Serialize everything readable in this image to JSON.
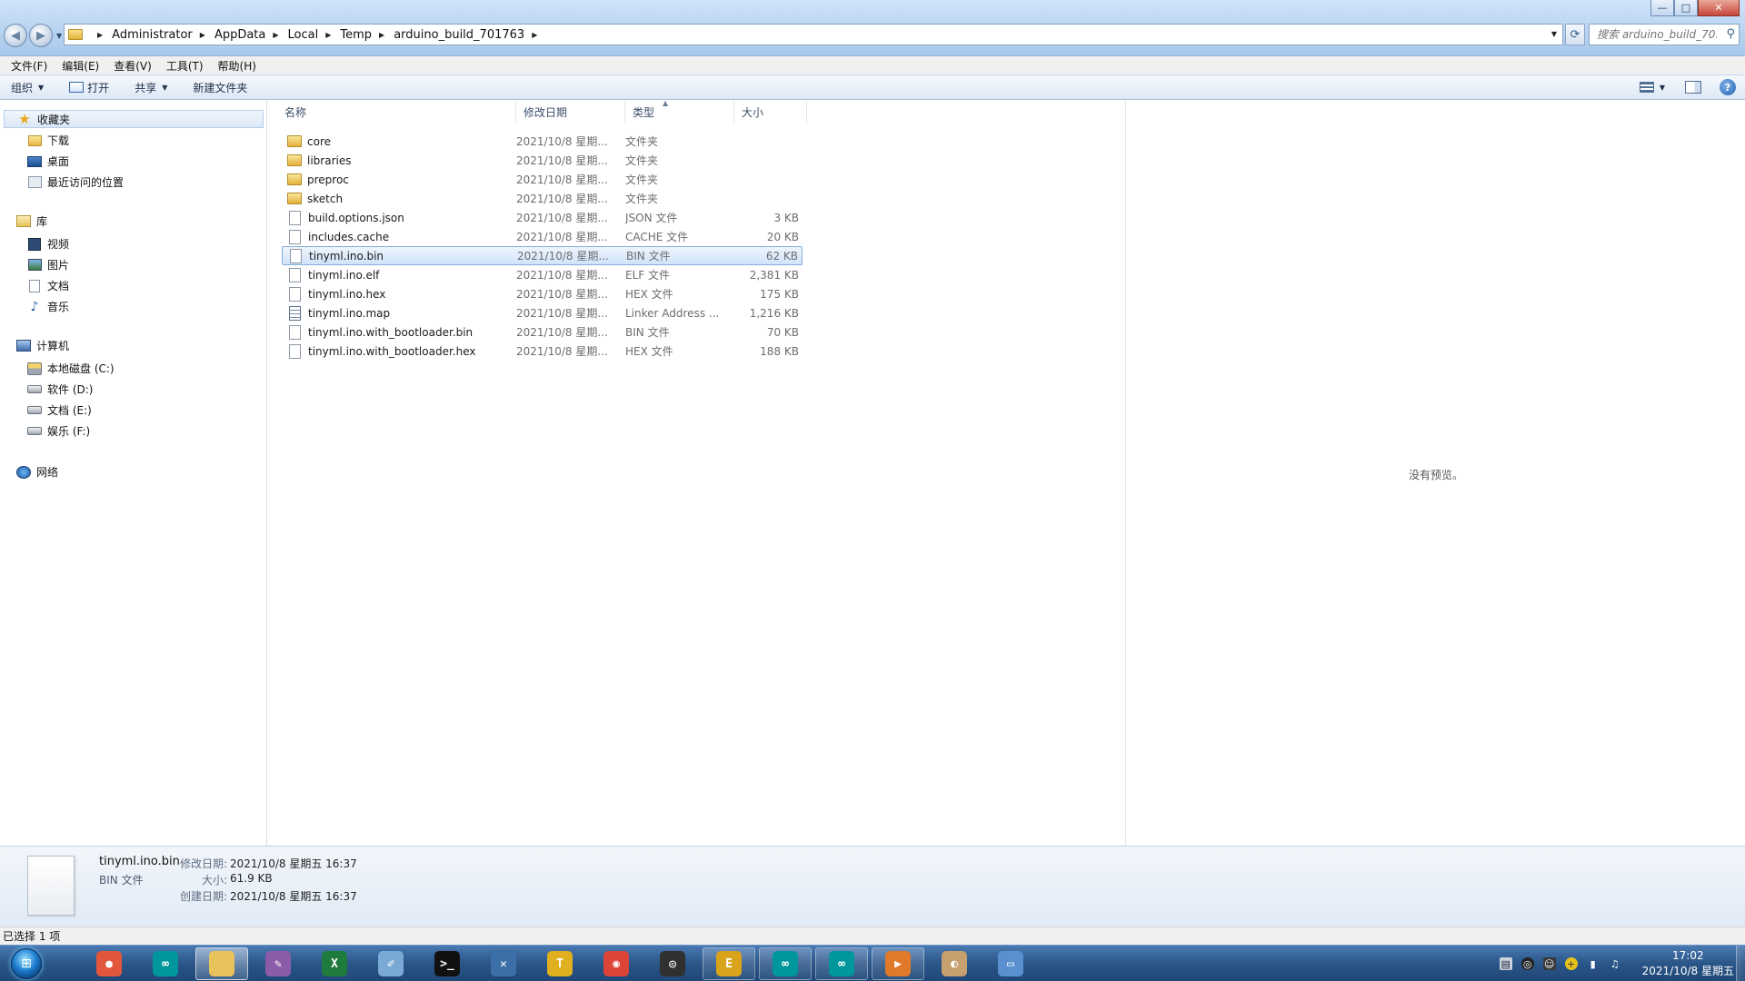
{
  "window": {
    "breadcrumbs": [
      "Administrator",
      "AppData",
      "Local",
      "Temp",
      "arduino_build_701763"
    ],
    "search_placeholder": "搜索 arduino_build_70...",
    "controls": {
      "minimize": "—",
      "maximize": "□",
      "close": "✕"
    }
  },
  "menu": [
    "文件(F)",
    "编辑(E)",
    "查看(V)",
    "工具(T)",
    "帮助(H)"
  ],
  "commands": {
    "organize": "组织",
    "open": "打开",
    "share": "共享",
    "new_folder": "新建文件夹"
  },
  "nav": {
    "favorites": {
      "label": "收藏夹",
      "items": [
        "下载",
        "桌面",
        "最近访问的位置"
      ]
    },
    "libraries": {
      "label": "库",
      "items": [
        "视频",
        "图片",
        "文档",
        "音乐"
      ]
    },
    "computer": {
      "label": "计算机",
      "items": [
        "本地磁盘 (C:)",
        "软件 (D:)",
        "文档 (E:)",
        "娱乐 (F:)"
      ]
    },
    "network": {
      "label": "网络"
    }
  },
  "columns": {
    "name": "名称",
    "date": "修改日期",
    "type": "类型",
    "size": "大小"
  },
  "files": [
    {
      "name": "core",
      "date": "2021/10/8 星期...",
      "type": "文件夹",
      "size": "",
      "kind": "folder"
    },
    {
      "name": "libraries",
      "date": "2021/10/8 星期...",
      "type": "文件夹",
      "size": "",
      "kind": "folder"
    },
    {
      "name": "preproc",
      "date": "2021/10/8 星期...",
      "type": "文件夹",
      "size": "",
      "kind": "folder"
    },
    {
      "name": "sketch",
      "date": "2021/10/8 星期...",
      "type": "文件夹",
      "size": "",
      "kind": "folder"
    },
    {
      "name": "build.options.json",
      "date": "2021/10/8 星期...",
      "type": "JSON 文件",
      "size": "3 KB",
      "kind": "file"
    },
    {
      "name": "includes.cache",
      "date": "2021/10/8 星期...",
      "type": "CACHE 文件",
      "size": "20 KB",
      "kind": "file"
    },
    {
      "name": "tinyml.ino.bin",
      "date": "2021/10/8 星期...",
      "type": "BIN 文件",
      "size": "62 KB",
      "kind": "file",
      "selected": true
    },
    {
      "name": "tinyml.ino.elf",
      "date": "2021/10/8 星期...",
      "type": "ELF 文件",
      "size": "2,381 KB",
      "kind": "file"
    },
    {
      "name": "tinyml.ino.hex",
      "date": "2021/10/8 星期...",
      "type": "HEX 文件",
      "size": "175 KB",
      "kind": "file"
    },
    {
      "name": "tinyml.ino.map",
      "date": "2021/10/8 星期...",
      "type": "Linker Address ...",
      "size": "1,216 KB",
      "kind": "map"
    },
    {
      "name": "tinyml.ino.with_bootloader.bin",
      "date": "2021/10/8 星期...",
      "type": "BIN 文件",
      "size": "70 KB",
      "kind": "file"
    },
    {
      "name": "tinyml.ino.with_bootloader.hex",
      "date": "2021/10/8 星期...",
      "type": "HEX 文件",
      "size": "188 KB",
      "kind": "file"
    }
  ],
  "preview": {
    "message": "没有预览。"
  },
  "details": {
    "name": "tinyml.ino.bin",
    "type": "BIN 文件",
    "modified_label": "修改日期:",
    "modified": "2021/10/8 星期五 16:37",
    "size_label": "大小:",
    "size": "61.9 KB",
    "created_label": "创建日期:",
    "created": "2021/10/8 星期五 16:37"
  },
  "status": {
    "selection": "已选择 1 项"
  },
  "taskbar": {
    "apps": [
      {
        "name": "multicolor-icon",
        "glyph": "●",
        "color": "#e2573b",
        "state": ""
      },
      {
        "name": "arduino-icon",
        "glyph": "∞",
        "color": "#00979c",
        "state": ""
      },
      {
        "name": "explorer-icon",
        "glyph": "",
        "color": "#e8c25a",
        "state": "active"
      },
      {
        "name": "paint-tool-icon",
        "glyph": "✎",
        "color": "#8c5ca8",
        "state": ""
      },
      {
        "name": "excel-icon",
        "glyph": "X",
        "color": "#1f7a3e",
        "state": ""
      },
      {
        "name": "notepad-icon",
        "glyph": "✐",
        "color": "#7aa9d6",
        "state": ""
      },
      {
        "name": "cmd-icon",
        "glyph": ">_",
        "color": "#111111",
        "state": ""
      },
      {
        "name": "diagram-tool-icon",
        "glyph": "✕",
        "color": "#3c6fa8",
        "state": ""
      },
      {
        "name": "text-tool-icon",
        "glyph": "T",
        "color": "#e0b020",
        "state": ""
      },
      {
        "name": "chrome-icon",
        "glyph": "◉",
        "color": "#db4437",
        "state": ""
      },
      {
        "name": "obs-icon",
        "glyph": "◎",
        "color": "#303030",
        "state": ""
      },
      {
        "name": "e-tool-icon",
        "glyph": "E",
        "color": "#d9a41c",
        "state": "open"
      },
      {
        "name": "arduino-icon-2",
        "glyph": "∞",
        "color": "#00979c",
        "state": "open"
      },
      {
        "name": "arduino-icon-3",
        "glyph": "∞",
        "color": "#00979c",
        "state": "open"
      },
      {
        "name": "media-player-icon",
        "glyph": "▶",
        "color": "#e07a2a",
        "state": "open"
      },
      {
        "name": "palette-icon",
        "glyph": "◐",
        "color": "#c8a070",
        "state": ""
      },
      {
        "name": "window-tool-icon",
        "glyph": "▭",
        "color": "#5a8fd0",
        "state": ""
      }
    ],
    "time": "17:02",
    "date": "2021/10/8 星期五"
  }
}
